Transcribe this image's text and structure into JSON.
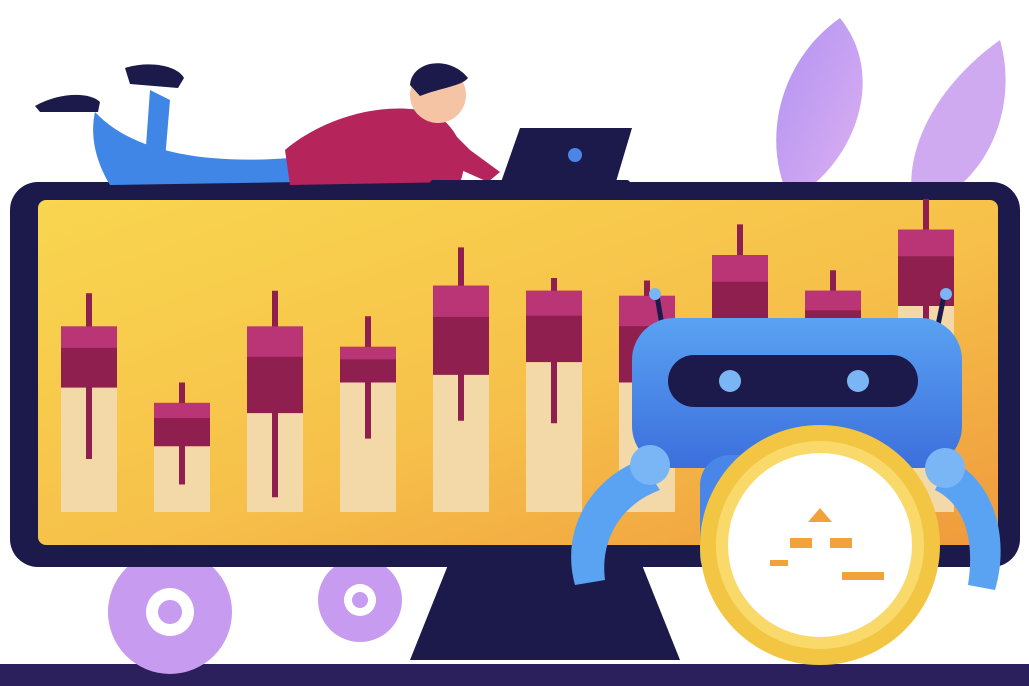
{
  "scene": {
    "description_visible_text": "",
    "colors": {
      "background": "#ffffff",
      "monitor_frame": "#1c1a4a",
      "screen_yellow": "#f7c84a",
      "screen_orange": "#f2a03a",
      "candle_body": "#8e1f4e",
      "candle_highlight": "#c23a7e",
      "candle_shadow": "#f4d9a8",
      "robot_blue": "#4a86e8",
      "robot_light": "#7ab6f5",
      "robot_dark": "#1c1a4a",
      "coin_gold": "#f2c542",
      "leaf_purple": "#b78cf0",
      "gear_purple": "#c79bef",
      "person_shirt": "#b5245b",
      "person_jeans": "#3f86e6",
      "person_hair": "#1c1a4a",
      "laptop": "#1c1a4a"
    },
    "candles": [
      {
        "open": 0.28,
        "close": 0.52,
        "high": 0.15,
        "low": 0.8
      },
      {
        "open": 0.58,
        "close": 0.75,
        "high": 0.5,
        "low": 0.9
      },
      {
        "open": 0.28,
        "close": 0.62,
        "high": 0.14,
        "low": 0.95
      },
      {
        "open": 0.36,
        "close": 0.5,
        "high": 0.24,
        "low": 0.72
      },
      {
        "open": 0.12,
        "close": 0.47,
        "high": -0.03,
        "low": 0.65
      },
      {
        "open": 0.14,
        "close": 0.42,
        "high": 0.09,
        "low": 0.66
      },
      {
        "open": 0.16,
        "close": 0.5,
        "high": 0.1,
        "low": 0.62
      },
      {
        "open": 0.0,
        "close": 0.3,
        "high": -0.12,
        "low": 0.4
      },
      {
        "open": 0.14,
        "close": 0.36,
        "high": 0.06,
        "low": 0.46
      },
      {
        "open": -0.1,
        "close": 0.2,
        "high": -0.22,
        "low": 0.32
      }
    ]
  }
}
